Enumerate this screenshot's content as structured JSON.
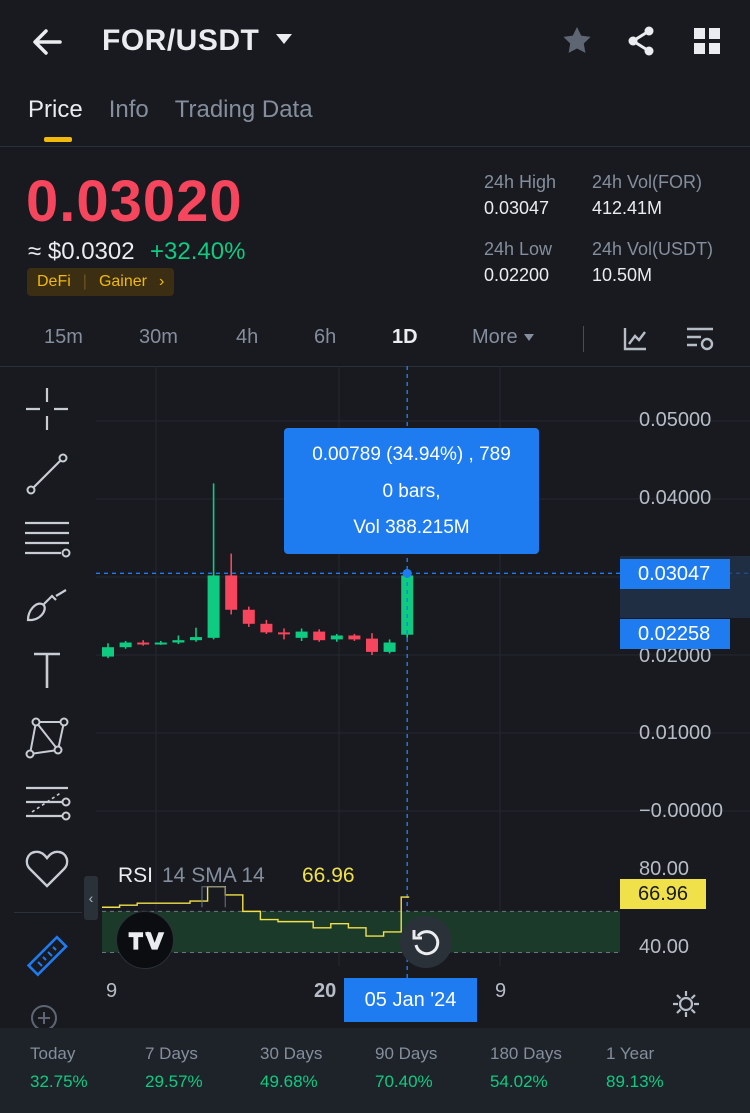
{
  "header": {
    "pair": "FOR/USDT",
    "back_icon": "arrow-left-icon",
    "favorite_icon": "star-icon",
    "share_icon": "share-icon",
    "more_icon": "grid-icon"
  },
  "tabs": [
    {
      "label": "Price",
      "active": true
    },
    {
      "label": "Info",
      "active": false
    },
    {
      "label": "Trading Data",
      "active": false
    }
  ],
  "ticker": {
    "last_price": "0.03020",
    "usd_price": "≈ $0.0302",
    "change": "+32.40%",
    "tags": [
      "DeFi",
      "Gainer"
    ],
    "tag_chevron": "›",
    "stats": {
      "high_label": "24h High",
      "high_value": "0.03047",
      "low_label": "24h Low",
      "low_value": "0.02200",
      "vol_base_label": "24h Vol(FOR)",
      "vol_base_value": "412.41M",
      "vol_quote_label": "24h Vol(USDT)",
      "vol_quote_value": "10.50M"
    },
    "colors": {
      "down": "#f6465d",
      "up": "#0ecb81",
      "accent": "#f0b90b",
      "highlight": "#1f7cf0"
    }
  },
  "intervals": {
    "items": [
      "15m",
      "30m",
      "4h",
      "6h",
      "1D"
    ],
    "active": "1D",
    "more_label": "More",
    "indicator_icon": "indicator-icon",
    "settings_icon": "chart-settings-icon"
  },
  "drawing_tools": [
    "crosshair-icon",
    "trend-line-icon",
    "horizontal-lines-icon",
    "brush-icon",
    "text-icon",
    "pattern-icon",
    "fib-icon",
    "favorite-heart-icon",
    "ruler-icon",
    "zoom-icon"
  ],
  "measure": {
    "line1": "0.00789 (34.94%) , 789",
    "line2": "0 bars,",
    "line3": "Vol 388.215M"
  },
  "price_axis": {
    "labels": [
      "0.05000",
      "0.04000",
      "0.02000",
      "0.01000",
      "−0.00000"
    ],
    "marker_high": "0.03047",
    "marker_low": "0.02258"
  },
  "chart_data": {
    "type": "candlestick",
    "ylim": [
      0,
      0.05
    ],
    "candles": [
      {
        "o": 0.0198,
        "h": 0.0215,
        "l": 0.0196,
        "c": 0.021
      },
      {
        "o": 0.021,
        "h": 0.0218,
        "l": 0.0208,
        "c": 0.0216
      },
      {
        "o": 0.0216,
        "h": 0.0219,
        "l": 0.0212,
        "c": 0.0214
      },
      {
        "o": 0.0214,
        "h": 0.0218,
        "l": 0.0213,
        "c": 0.0216
      },
      {
        "o": 0.0216,
        "h": 0.0225,
        "l": 0.0214,
        "c": 0.0219
      },
      {
        "o": 0.0219,
        "h": 0.0235,
        "l": 0.0217,
        "c": 0.0223
      },
      {
        "o": 0.0222,
        "h": 0.042,
        "l": 0.022,
        "c": 0.0302
      },
      {
        "o": 0.0302,
        "h": 0.033,
        "l": 0.0252,
        "c": 0.0258
      },
      {
        "o": 0.0258,
        "h": 0.0262,
        "l": 0.0236,
        "c": 0.024
      },
      {
        "o": 0.024,
        "h": 0.0245,
        "l": 0.0227,
        "c": 0.0229
      },
      {
        "o": 0.0229,
        "h": 0.0234,
        "l": 0.022,
        "c": 0.0227
      },
      {
        "o": 0.0222,
        "h": 0.0234,
        "l": 0.0218,
        "c": 0.023
      },
      {
        "o": 0.023,
        "h": 0.0233,
        "l": 0.0217,
        "c": 0.0219
      },
      {
        "o": 0.022,
        "h": 0.0227,
        "l": 0.0217,
        "c": 0.0225
      },
      {
        "o": 0.0225,
        "h": 0.0227,
        "l": 0.0218,
        "c": 0.022
      },
      {
        "o": 0.0221,
        "h": 0.0228,
        "l": 0.02,
        "c": 0.0204
      },
      {
        "o": 0.0204,
        "h": 0.022,
        "l": 0.0202,
        "c": 0.0216
      },
      {
        "o": 0.0226,
        "h": 0.0305,
        "l": 0.0222,
        "c": 0.0302
      }
    ]
  },
  "rsi": {
    "label": "RSI",
    "params": "14 SMA 14",
    "value": "66.96",
    "axis_labels": [
      "80.00",
      "40.00"
    ],
    "ylim": [
      30,
      85
    ],
    "band": [
      40,
      60
    ],
    "series": [
      62,
      63,
      64,
      64,
      64,
      65,
      72,
      68,
      60,
      56,
      55,
      55,
      52,
      54,
      52,
      48,
      50,
      66.96
    ]
  },
  "time_axis": {
    "labels": [
      "9",
      "20",
      "9"
    ],
    "crosshair_date": "05 Jan '24",
    "gear_icon": "gear-icon"
  },
  "performance": [
    {
      "label": "Today",
      "value": "32.75%"
    },
    {
      "label": "7 Days",
      "value": "29.57%"
    },
    {
      "label": "30 Days",
      "value": "49.68%"
    },
    {
      "label": "90 Days",
      "value": "70.40%"
    },
    {
      "label": "180 Days",
      "value": "54.02%"
    },
    {
      "label": "1 Year",
      "value": "89.13%"
    }
  ]
}
